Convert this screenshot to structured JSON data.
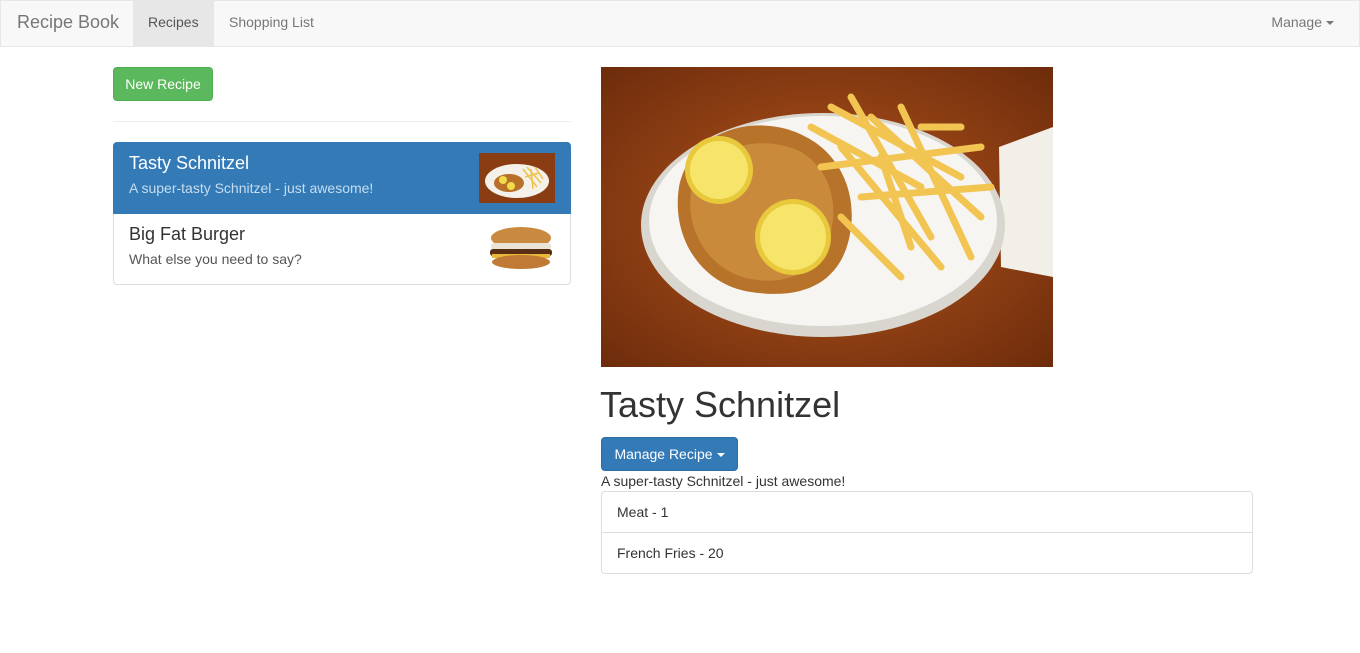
{
  "navbar": {
    "brand": "Recipe Book",
    "links": [
      {
        "label": "Recipes",
        "active": true
      },
      {
        "label": "Shopping List",
        "active": false
      }
    ],
    "manage_label": "Manage"
  },
  "sidebar": {
    "new_recipe_label": "New Recipe",
    "recipes": [
      {
        "name": "Tasty Schnitzel",
        "description": "A super-tasty Schnitzel - just awesome!",
        "active": true
      },
      {
        "name": "Big Fat Burger",
        "description": "What else you need to say?",
        "active": false
      }
    ]
  },
  "detail": {
    "title": "Tasty Schnitzel",
    "manage_recipe_label": "Manage Recipe",
    "description": "A super-tasty Schnitzel - just awesome!",
    "ingredients": [
      "Meat - 1",
      "French Fries - 20"
    ]
  },
  "colors": {
    "primary": "#337ab7",
    "success": "#5cb85c",
    "navbar_bg": "#f8f8f8"
  }
}
